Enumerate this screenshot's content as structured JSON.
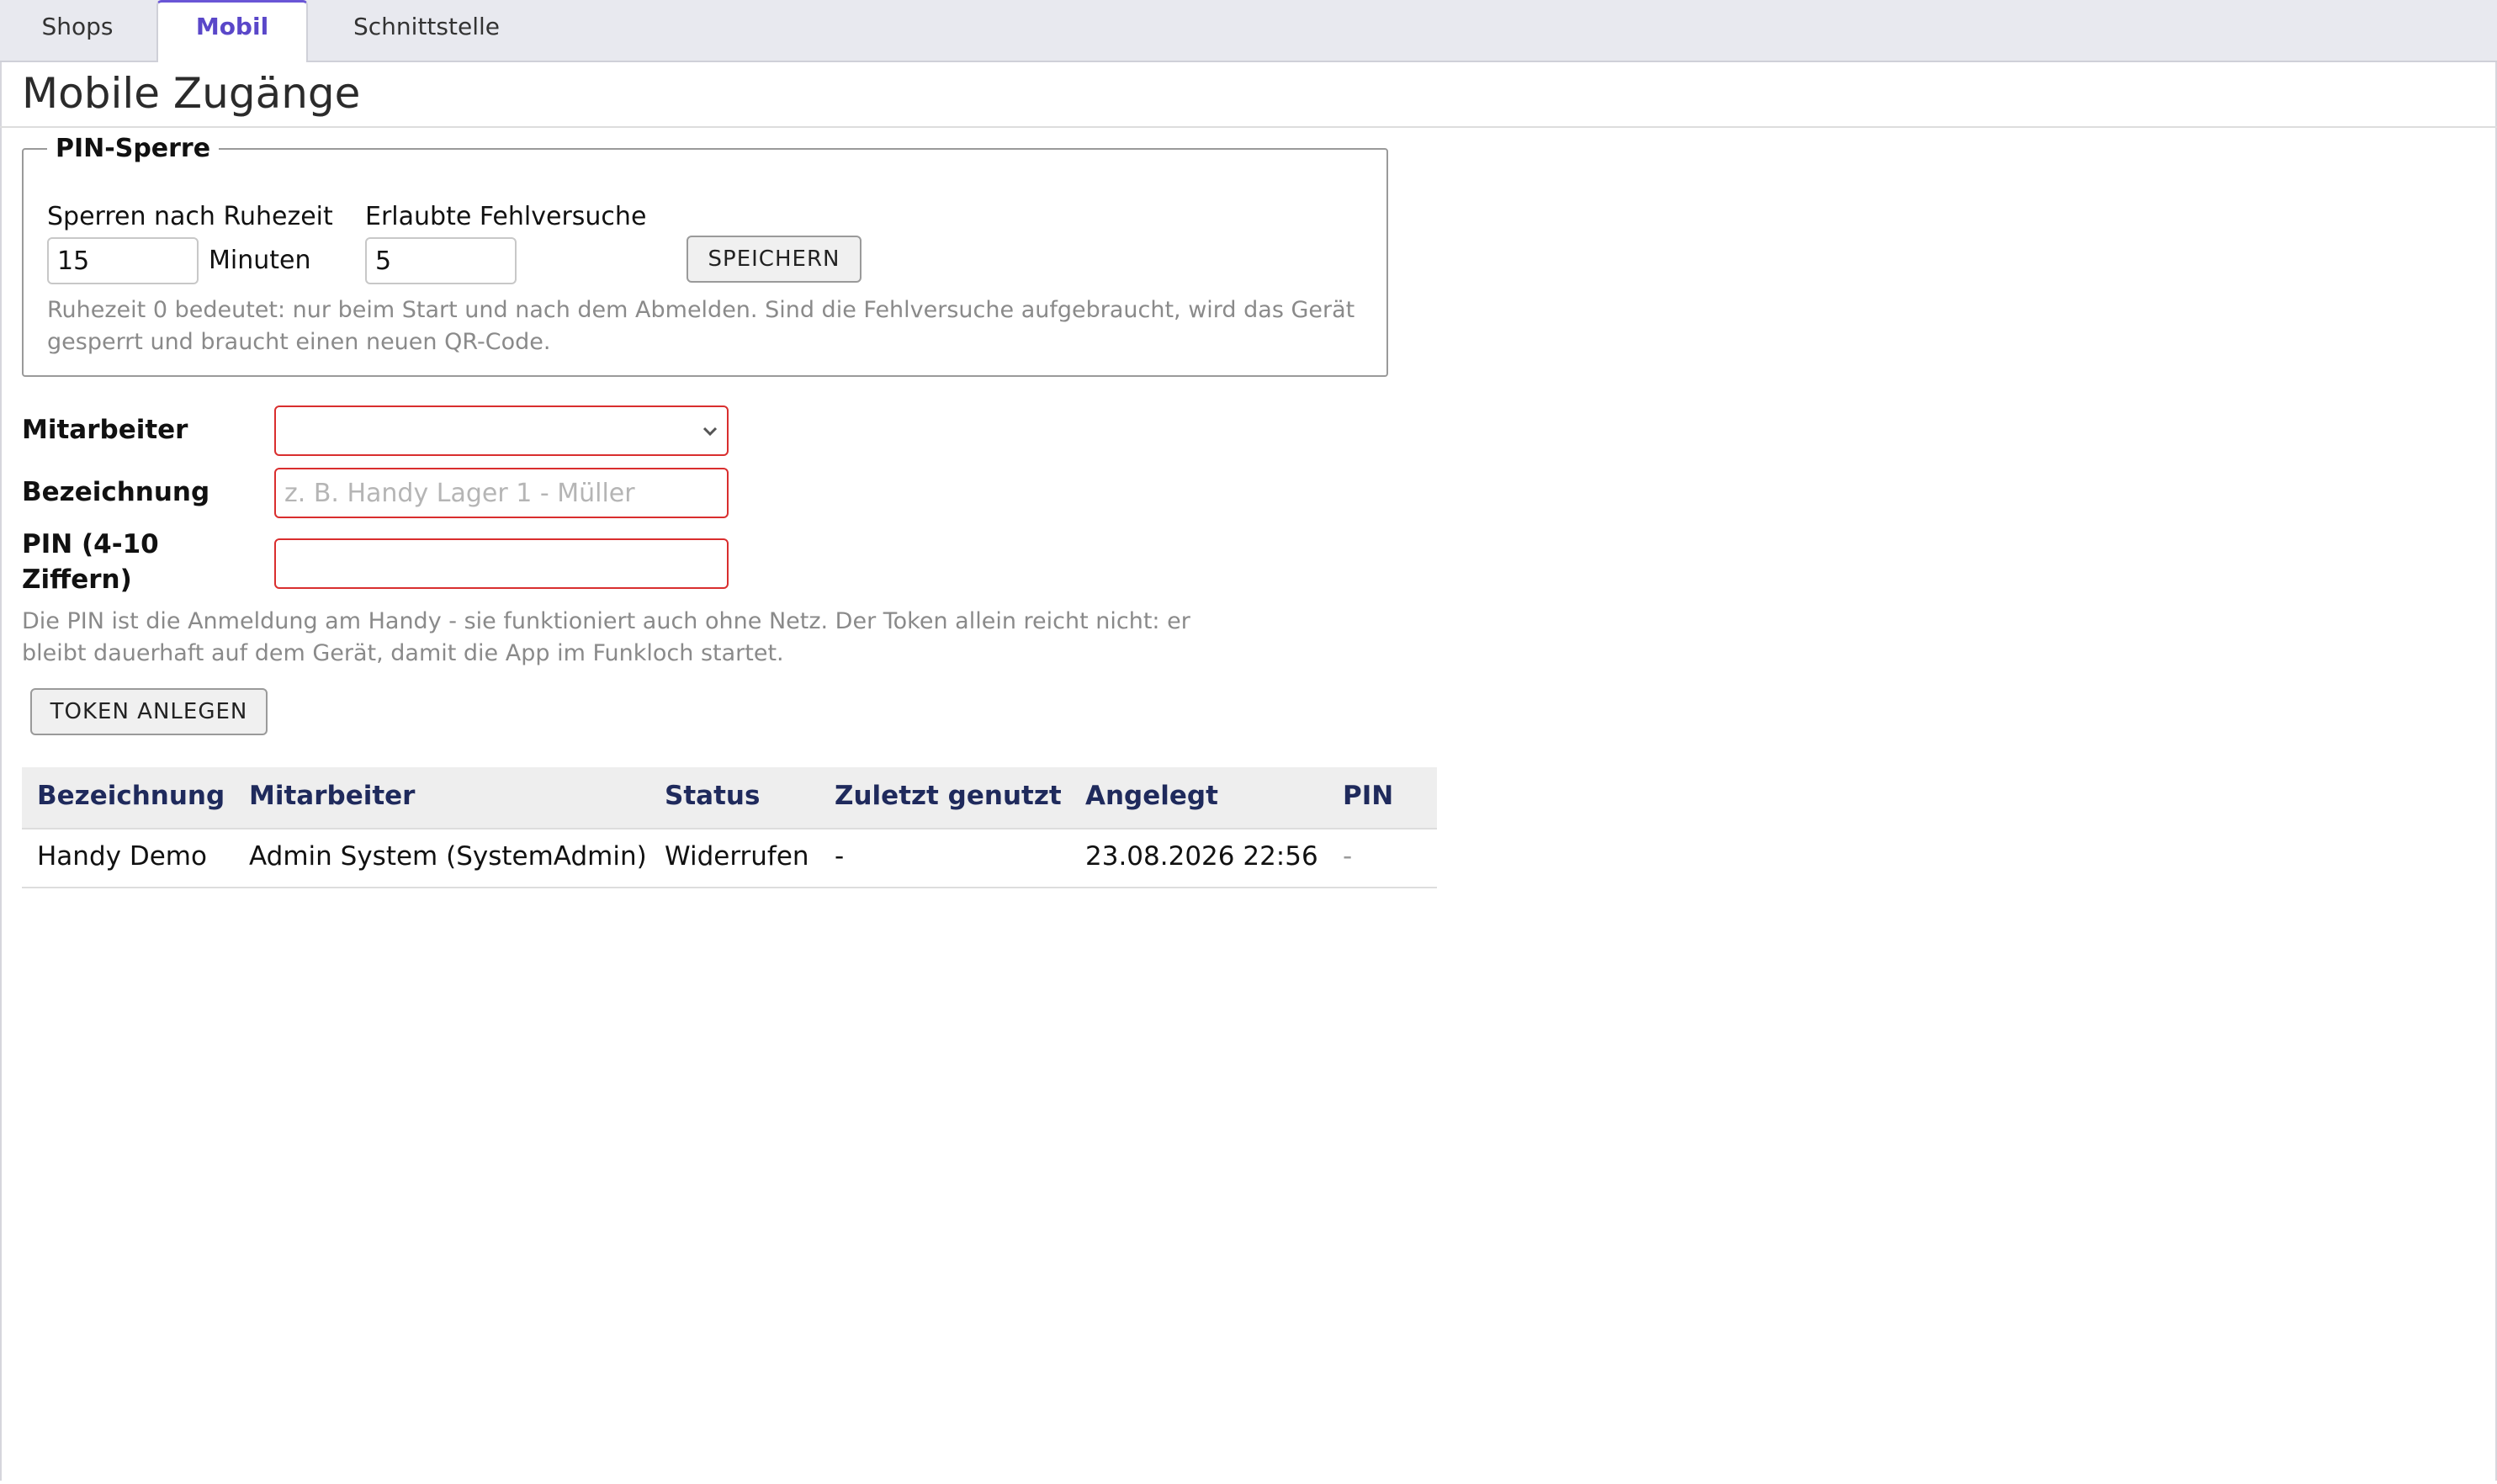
{
  "tabs": [
    {
      "label": "Shops",
      "active": false
    },
    {
      "label": "Mobil",
      "active": true
    },
    {
      "label": "Schnittstelle",
      "active": false
    }
  ],
  "page_title": "Mobile Zugänge",
  "pin_lock": {
    "legend": "PIN-Sperre",
    "idle_label": "Sperren nach Ruhezeit",
    "idle_value": "15",
    "idle_unit": "Minuten",
    "attempts_label": "Erlaubte Fehlversuche",
    "attempts_value": "5",
    "save_label": "SPEICHERN",
    "hint_line1": "Ruhezeit 0 bedeutet: nur beim Start und nach dem Abmelden. Sind die Fehlversuche aufgebraucht, wird das Gerät",
    "hint_line2": "gesperrt und braucht einen neuen QR-Code."
  },
  "form": {
    "employee_label": "Mitarbeiter",
    "employee_value": "",
    "designation_label": "Bezeichnung",
    "designation_placeholder": "z. B. Handy Lager 1 - Müller",
    "designation_value": "",
    "pin_label_line1": "PIN (4-10",
    "pin_label_line2": "Ziffern)",
    "pin_value": "",
    "hint_line1": "Die PIN ist die Anmeldung am Handy - sie funktioniert auch ohne Netz. Der Token allein reicht nicht: er",
    "hint_line2": "bleibt dauerhaft auf dem Gerät, damit die App im Funkloch startet.",
    "create_label": "TOKEN ANLEGEN"
  },
  "table": {
    "headers": [
      "Bezeichnung",
      "Mitarbeiter",
      "Status",
      "Zuletzt genutzt",
      "Angelegt",
      "PIN"
    ],
    "rows": [
      [
        "Handy Demo",
        "Admin System (SystemAdmin)",
        "Widerrufen",
        "-",
        "23.08.2026 22:56",
        "-"
      ]
    ]
  },
  "colors": {
    "accent": "#5a47c9",
    "error_border": "#d92e2e",
    "table_header_text": "#1f2a5c"
  },
  "icons": {
    "select_arrow": "chevron-down-icon"
  }
}
